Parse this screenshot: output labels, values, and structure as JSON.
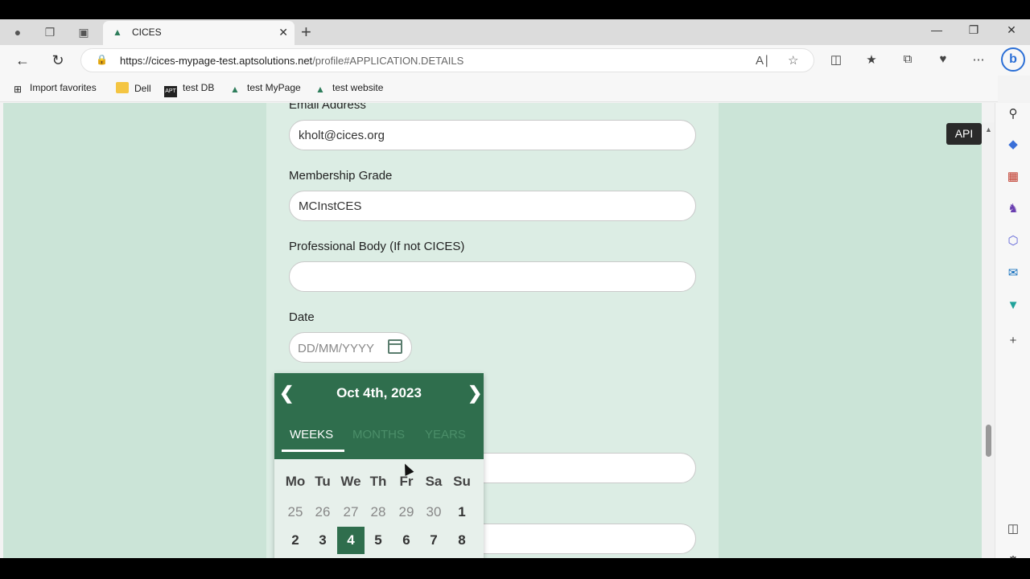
{
  "browser": {
    "tab_title": "CICES",
    "new_tab_symbol": "+",
    "url_host": "https://cices-mypage-test.aptsolutions.net",
    "url_path": "/profile#APPLICATION.DETAILS"
  },
  "bookmarks": [
    {
      "label": "Import favorites",
      "icon": "import-icon"
    },
    {
      "label": "Dell",
      "icon": "folder-icon"
    },
    {
      "label": "test DB",
      "icon": "apt-logo-icon"
    },
    {
      "label": "test MyPage",
      "icon": "cices-logo-icon"
    },
    {
      "label": "test website",
      "icon": "cices-logo-icon"
    }
  ],
  "form": {
    "email_label": "Email Address",
    "email_value": "kholt@cices.org",
    "grade_label": "Membership Grade",
    "grade_value": "MCInstCES",
    "body_label": "Professional Body (If not CICES)",
    "body_value": "",
    "date_label": "Date",
    "date_placeholder": "DD/MM/YYYY"
  },
  "datepicker": {
    "title": "Oct 4th, 2023",
    "tabs": [
      "WEEKS",
      "MONTHS",
      "YEARS"
    ],
    "active_tab": "WEEKS",
    "weekdays": [
      "Mo",
      "Tu",
      "We",
      "Th",
      "Fr",
      "Sa",
      "Su"
    ],
    "rows": [
      [
        {
          "d": "25",
          "other": true
        },
        {
          "d": "26",
          "other": true
        },
        {
          "d": "27",
          "other": true
        },
        {
          "d": "28",
          "other": true
        },
        {
          "d": "29",
          "other": true
        },
        {
          "d": "30",
          "other": true
        },
        {
          "d": "1",
          "other": false
        }
      ],
      [
        {
          "d": "2",
          "other": false
        },
        {
          "d": "3",
          "other": false
        },
        {
          "d": "4",
          "other": false,
          "selected": true
        },
        {
          "d": "5",
          "other": false
        },
        {
          "d": "6",
          "other": false
        },
        {
          "d": "7",
          "other": false
        },
        {
          "d": "8",
          "other": false
        }
      ]
    ]
  },
  "overlay": {
    "api_badge": "API"
  },
  "colors": {
    "accent": "#2f6e4d",
    "page_bg": "#cbe4d7",
    "panel_bg": "#dcede4"
  }
}
